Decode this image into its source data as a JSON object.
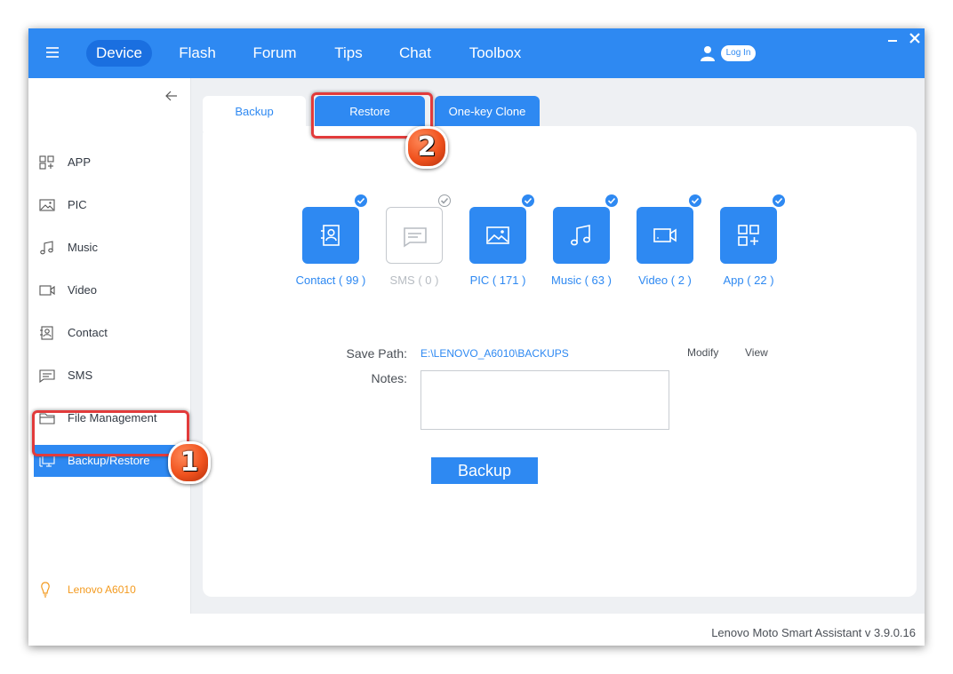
{
  "topbar": {
    "tabs": [
      {
        "label": "Device",
        "active": true
      },
      {
        "label": "Flash",
        "active": false
      },
      {
        "label": "Forum",
        "active": false
      },
      {
        "label": "Tips",
        "active": false
      },
      {
        "label": "Chat",
        "active": false
      },
      {
        "label": "Toolbox",
        "active": false
      }
    ],
    "login_label": "Log In",
    "minimize_glyph": "–",
    "close_glyph": "×"
  },
  "sidebar": {
    "items": [
      {
        "label": "APP",
        "icon": "app-grid-icon"
      },
      {
        "label": "PIC",
        "icon": "picture-icon"
      },
      {
        "label": "Music",
        "icon": "music-note-icon"
      },
      {
        "label": "Video",
        "icon": "video-camera-icon"
      },
      {
        "label": "Contact",
        "icon": "contact-card-icon"
      },
      {
        "label": "SMS",
        "icon": "message-icon"
      },
      {
        "label": "File Management",
        "icon": "folder-icon"
      },
      {
        "label": "Backup/Restore",
        "icon": "backup-restore-icon",
        "active": true
      }
    ],
    "device_name": "Lenovo A6010"
  },
  "content_tabs": {
    "backup": "Backup",
    "restore": "Restore",
    "clone": "One-key Clone"
  },
  "categories": [
    {
      "label": "Contact ( 99 )",
      "checked": true,
      "icon": "contact-card-icon"
    },
    {
      "label": "SMS ( 0 )",
      "checked": false,
      "icon": "message-icon"
    },
    {
      "label": "PIC ( 171 )",
      "checked": true,
      "icon": "picture-icon"
    },
    {
      "label": "Music ( 63 )",
      "checked": true,
      "icon": "music-note-icon"
    },
    {
      "label": "Video ( 2 )",
      "checked": true,
      "icon": "video-camera-icon"
    },
    {
      "label": "App ( 22 )",
      "checked": true,
      "icon": "app-grid-icon"
    }
  ],
  "form": {
    "save_path_label": "Save Path:",
    "save_path_value": "E:\\LENOVO_A6010\\BACKUPS",
    "modify_label": "Modify",
    "view_label": "View",
    "notes_label": "Notes:",
    "notes_value": "",
    "backup_button": "Backup"
  },
  "footer": {
    "version": "Lenovo Moto Smart Assistant v 3.9.0.16"
  },
  "annotations": {
    "step1": "1",
    "step2": "2"
  },
  "colors": {
    "accent": "#2e89f2",
    "device_text": "#f39a1e",
    "highlight": "#e23b3b"
  }
}
